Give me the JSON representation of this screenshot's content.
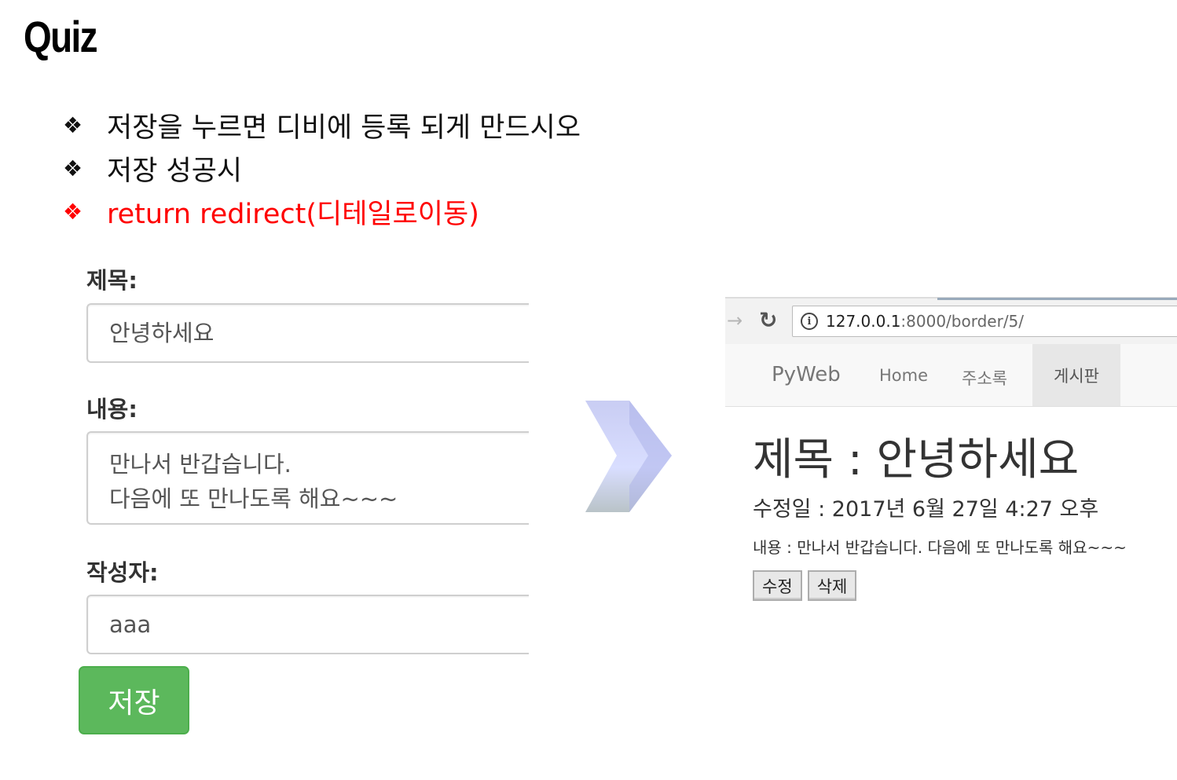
{
  "slide": {
    "title": "Quiz",
    "bullet_mark": "❖",
    "bullets": [
      "저장을 누르면 디비에 등록 되게 만드시오",
      "저장 성공시",
      "return redirect(디테일로이동)"
    ],
    "colors": {
      "normal": "#111111",
      "highlight": "#ff0000"
    }
  },
  "form": {
    "title_label": "제목:",
    "title_value": "안녕하세요",
    "content_label": "내용:",
    "content_lines": [
      "만나서 반갑습니다.",
      "다음에 또 만나도록 해요~~~"
    ],
    "author_label": "작성자:",
    "author_value": "aaa",
    "save_button": "저장",
    "save_color": "#5cb85c"
  },
  "browser": {
    "url_host": "127.0.0.1",
    "url_rest": ":8000/border/5/",
    "nav": {
      "brand": "PyWeb",
      "items": [
        "Home",
        "주소록",
        "게시판"
      ],
      "active_index": 2
    },
    "detail": {
      "title": "제목 : 안녕하세요",
      "date": "수정일 : 2017년 6월 27일 4:27 오후",
      "content": "내용 : 만나서 반갑습니다. 다음에 또 만나도록 해요~~~",
      "edit_button": "수정",
      "delete_button": "삭제"
    }
  }
}
